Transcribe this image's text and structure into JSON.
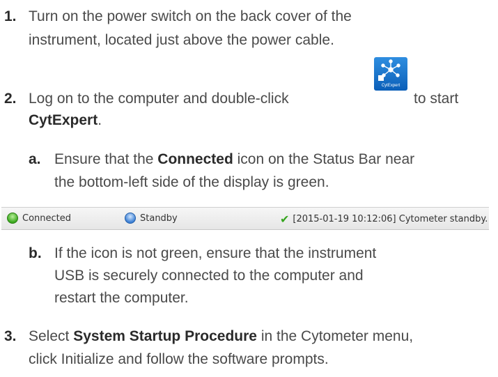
{
  "steps": [
    {
      "num": "1.",
      "line1": "Turn on the power switch on the back cover of the",
      "line2": "instrument, located just above the power cable."
    },
    {
      "num": "2.",
      "line1_pre": "Log on to the computer and double-click",
      "line1_post": "to start",
      "line2_bold": "CytExpert",
      "line2_post": "."
    },
    {
      "num": "3.",
      "line1_pre": "Select",
      "line1_bold": "System Startup Procedure",
      "line1_post": "in the Cytometer menu,",
      "line2": "click Initialize and follow the software prompts."
    }
  ],
  "substeps": [
    {
      "letter": "a.",
      "line1_pre": "Ensure that the",
      "line1_bold": "Connected",
      "line1_post": "icon on the Status Bar near",
      "line2": "the bottom-left side of the display is green."
    },
    {
      "letter": "b.",
      "line1": "If the icon is not green, ensure that the instrument",
      "line2": "USB is securely connected to the computer and",
      "line3": "restart the computer."
    }
  ],
  "app_icon": {
    "label": "CytExpert",
    "icon": "cytexpert-app-icon",
    "color": "#1f78d1"
  },
  "status_bar": {
    "connected": {
      "label": "Connected",
      "icon": "green-status-dot",
      "color": "#3aa81e"
    },
    "standby": {
      "label": "Standby",
      "icon": "blue-status-dot",
      "color": "#3b7fd4"
    },
    "message": {
      "text": "[2015-01-19 10:12:06] Cytometer standby.",
      "icon": "check-icon",
      "color": "#35a51e"
    }
  }
}
